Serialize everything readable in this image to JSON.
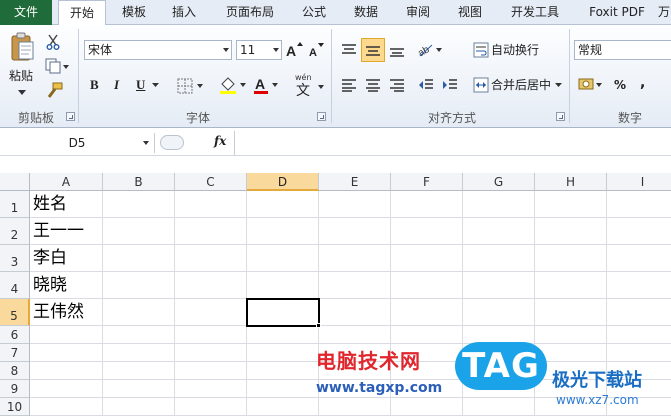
{
  "ribbon": {
    "tabs": [
      "文件",
      "开始",
      "模板",
      "插入",
      "页面布局",
      "公式",
      "数据",
      "审阅",
      "视图",
      "开发工具",
      "Foxit PDF",
      "万"
    ],
    "active_tab": "开始",
    "clipboard": {
      "paste_label": "粘贴",
      "group_label": "剪贴板"
    },
    "font": {
      "name": "宋体",
      "size": "11",
      "group_label": "字体",
      "bold": "B",
      "italic": "I",
      "underline": "U",
      "fontcolor": "A",
      "phonetic": "wén"
    },
    "alignment": {
      "wrap_label": "自动换行",
      "merge_label": "合并后居中",
      "group_label": "对齐方式"
    },
    "number": {
      "format": "常规",
      "percent": "%",
      "comma": ",",
      "group_label": "数字"
    }
  },
  "formula_bar": {
    "name_box": "D5",
    "fx_label": "fx",
    "content": ""
  },
  "sheet": {
    "columns": [
      "A",
      "B",
      "C",
      "D",
      "E",
      "F",
      "G",
      "H",
      "I"
    ],
    "rows": [
      "1",
      "2",
      "3",
      "4",
      "5",
      "6",
      "7",
      "8",
      "9",
      "10"
    ],
    "selected_column": "D",
    "selected_row": "5",
    "cells_A": [
      "姓名",
      "王一一",
      "李白",
      "晓晓",
      "王伟然"
    ]
  },
  "watermark": {
    "site_cn": "电脑技术网",
    "site_url": "www.tagxp.com",
    "logo_text": "TAG",
    "brand_cn": "极光下载站",
    "brand_url": "www.xz7.com"
  }
}
